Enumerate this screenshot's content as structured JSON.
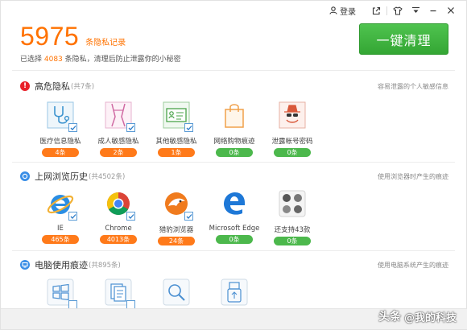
{
  "topbar": {
    "login_label": "登录"
  },
  "summary": {
    "count": "5975",
    "count_unit": "条隐私记录",
    "selected_prefix": "已选择 ",
    "selected_count": "4083",
    "selected_suffix": " 条隐私，清理后防止泄露你的小秘密"
  },
  "clean_button": {
    "label": "一键清理"
  },
  "sections": [
    {
      "title": "高危隐私",
      "count_label": "(共7条)",
      "note": "容易泄露的个人敏感信息",
      "items": [
        {
          "label": "医疗信息隐私",
          "badge": "4条",
          "badge_color": "orange"
        },
        {
          "label": "成人敏感隐私",
          "badge": "2条",
          "badge_color": "orange"
        },
        {
          "label": "其他敏感隐私",
          "badge": "1条",
          "badge_color": "orange"
        },
        {
          "label": "网络购物痕迹",
          "badge": "0条",
          "badge_color": "green"
        },
        {
          "label": "泄露帐号密码",
          "badge": "0条",
          "badge_color": "green"
        }
      ]
    },
    {
      "title": "上网浏览历史",
      "count_label": "(共4502条)",
      "note": "使用浏览器时产生的痕迹",
      "items": [
        {
          "label": "IE",
          "badge": "465条",
          "badge_color": "orange"
        },
        {
          "label": "Chrome",
          "badge": "4013条",
          "badge_color": "orange"
        },
        {
          "label": "猎豹浏览器",
          "badge": "24条",
          "badge_color": "orange"
        },
        {
          "label": "Microsoft Edge",
          "badge": "0条",
          "badge_color": "green"
        },
        {
          "label": "还支持43款",
          "badge": "0条",
          "badge_color": "green"
        }
      ]
    },
    {
      "title": "电脑使用痕迹",
      "count_label": "(共895条)",
      "note": "使用电脑系统产生的痕迹"
    }
  ],
  "watermark": {
    "text": "头条",
    "handle": "@我的科技"
  },
  "colors": {
    "accent_orange": "#ff7200",
    "accent_green": "#4cb84c",
    "danger_red": "#e8212a",
    "info_blue": "#3a8ee6"
  }
}
